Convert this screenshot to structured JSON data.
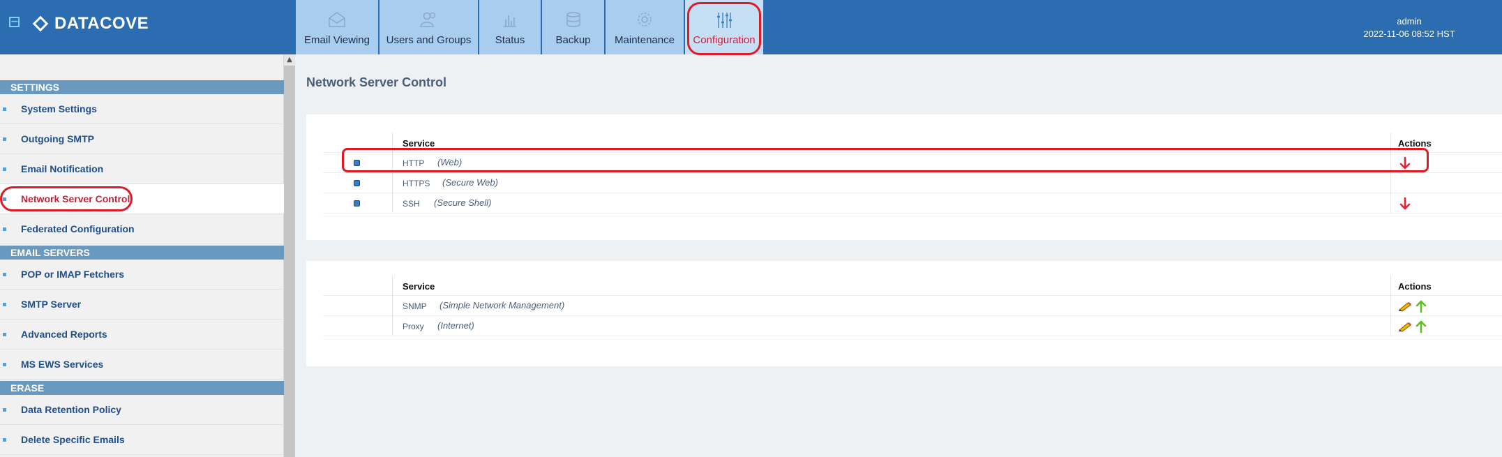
{
  "header": {
    "collapse_symbol": "−",
    "logo_text": "DATACOVE",
    "tabs": [
      {
        "label": "Email Viewing",
        "icon": "envelope-icon"
      },
      {
        "label": "Users and Groups",
        "icon": "users-icon"
      },
      {
        "label": "Status",
        "icon": "bar-chart-icon"
      },
      {
        "label": "Backup",
        "icon": "database-icon"
      },
      {
        "label": "Maintenance",
        "icon": "gear-icon"
      },
      {
        "label": "Configuration",
        "icon": "sliders-icon",
        "active": true
      }
    ],
    "user": "admin",
    "datetime": "2022-11-06 08:52 HST"
  },
  "sidebar": {
    "sections": [
      {
        "title": "SETTINGS",
        "items": [
          "System Settings",
          "Outgoing SMTP",
          "Email Notification",
          "Network Server Control",
          "Federated Configuration"
        ]
      },
      {
        "title": "EMAIL SERVERS",
        "items": [
          "POP or IMAP Fetchers",
          "SMTP Server",
          "Advanced Reports",
          "MS EWS Services"
        ]
      },
      {
        "title": "ERASE",
        "items": [
          "Data Retention Policy",
          "Delete Specific Emails"
        ]
      }
    ],
    "active_item": "Network Server Control"
  },
  "main": {
    "title": "Network Server Control",
    "running_table": {
      "col_service": "Service",
      "col_actions": "Actions",
      "rows": [
        {
          "service": "HTTP",
          "description": "(Web)",
          "actions": [
            "stop-arrow-icon"
          ]
        },
        {
          "service": "HTTPS",
          "description": "(Secure Web)",
          "actions": []
        },
        {
          "service": "SSH",
          "description": "(Secure Shell)",
          "actions": [
            "stop-arrow-icon"
          ]
        }
      ]
    },
    "stopped_table": {
      "col_service": "Service",
      "col_actions": "Actions",
      "rows": [
        {
          "service": "SNMP",
          "description": "(Simple Network Management)",
          "actions": [
            "edit-pencil-icon",
            "start-arrow-icon"
          ]
        },
        {
          "service": "Proxy",
          "description": "(Internet)",
          "actions": [
            "edit-pencil-icon",
            "start-arrow-icon"
          ]
        }
      ]
    }
  },
  "colors": {
    "header_bg": "#2b6db0",
    "tab_bg": "#a9cdef",
    "highlight": "#e01a24",
    "stop_arrow": "#e8203a",
    "start_arrow": "#5cc01e"
  }
}
